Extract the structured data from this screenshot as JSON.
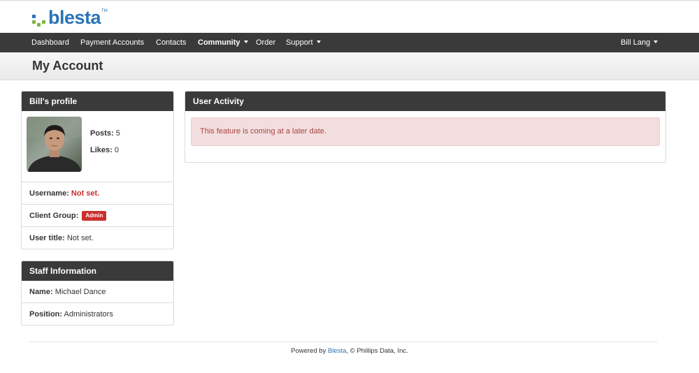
{
  "brand": {
    "name": "blesta",
    "tm": "TM"
  },
  "nav": {
    "items": [
      {
        "label": "Dashboard"
      },
      {
        "label": "Payment Accounts"
      },
      {
        "label": "Contacts"
      },
      {
        "label": "Community"
      },
      {
        "label": "Order"
      },
      {
        "label": "Support"
      }
    ],
    "user": "Bill Lang"
  },
  "page": {
    "title": "My Account"
  },
  "profile": {
    "title": "Bill's profile",
    "posts_label": "Posts:",
    "posts": "5",
    "likes_label": "Likes:",
    "likes": "0",
    "username_label": "Username:",
    "username": "Not set.",
    "group_label": "Client Group:",
    "group": "Admin",
    "usertitle_label": "User title:",
    "usertitle": "Not set."
  },
  "staff": {
    "title": "Staff Information",
    "name_label": "Name:",
    "name": "Michael Dance",
    "position_label": "Position:",
    "position": "Administrators"
  },
  "activity": {
    "title": "User Activity",
    "message": "This feature is coming at a later date."
  },
  "footer": {
    "prefix": "Powered by",
    "link": "Blesta",
    "suffix": ", © Phillips Data, Inc."
  }
}
